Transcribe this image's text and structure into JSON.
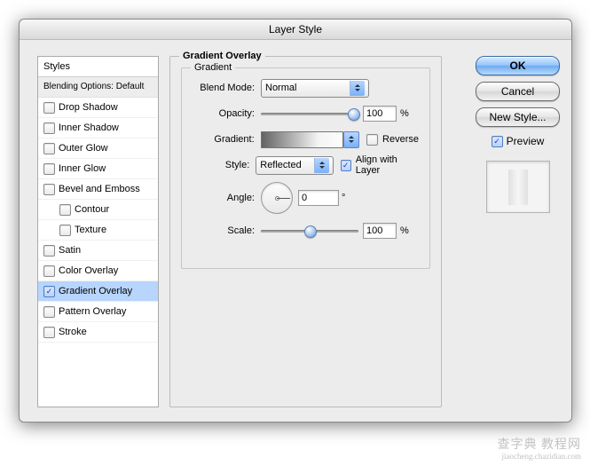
{
  "title": "Layer Style",
  "sidebar": {
    "header": "Styles",
    "subheader": "Blending Options: Default",
    "items": [
      {
        "label": "Drop Shadow",
        "checked": false,
        "selected": false
      },
      {
        "label": "Inner Shadow",
        "checked": false,
        "selected": false
      },
      {
        "label": "Outer Glow",
        "checked": false,
        "selected": false
      },
      {
        "label": "Inner Glow",
        "checked": false,
        "selected": false
      },
      {
        "label": "Bevel and Emboss",
        "checked": false,
        "selected": false
      },
      {
        "label": "Contour",
        "checked": false,
        "selected": false,
        "child": true
      },
      {
        "label": "Texture",
        "checked": false,
        "selected": false,
        "child": true
      },
      {
        "label": "Satin",
        "checked": false,
        "selected": false
      },
      {
        "label": "Color Overlay",
        "checked": false,
        "selected": false
      },
      {
        "label": "Gradient Overlay",
        "checked": true,
        "selected": true
      },
      {
        "label": "Pattern Overlay",
        "checked": false,
        "selected": false
      },
      {
        "label": "Stroke",
        "checked": false,
        "selected": false
      }
    ]
  },
  "panel": {
    "title": "Gradient Overlay",
    "group": "Gradient",
    "blend_mode": {
      "label": "Blend Mode:",
      "value": "Normal"
    },
    "opacity": {
      "label": "Opacity:",
      "value": "100",
      "unit": "%",
      "pct": 100
    },
    "gradient": {
      "label": "Gradient:",
      "reverse_label": "Reverse",
      "reverse": false
    },
    "style": {
      "label": "Style:",
      "value": "Reflected",
      "align_label": "Align with Layer",
      "align": true
    },
    "angle": {
      "label": "Angle:",
      "value": "0",
      "unit": "°"
    },
    "scale": {
      "label": "Scale:",
      "value": "100",
      "unit": "%",
      "pct": 50
    }
  },
  "buttons": {
    "ok": "OK",
    "cancel": "Cancel",
    "new_style": "New Style...",
    "preview": "Preview",
    "preview_checked": true
  },
  "watermark": {
    "main": "查字典 教程网",
    "sub": "jiaocheng.chazidian.com"
  }
}
